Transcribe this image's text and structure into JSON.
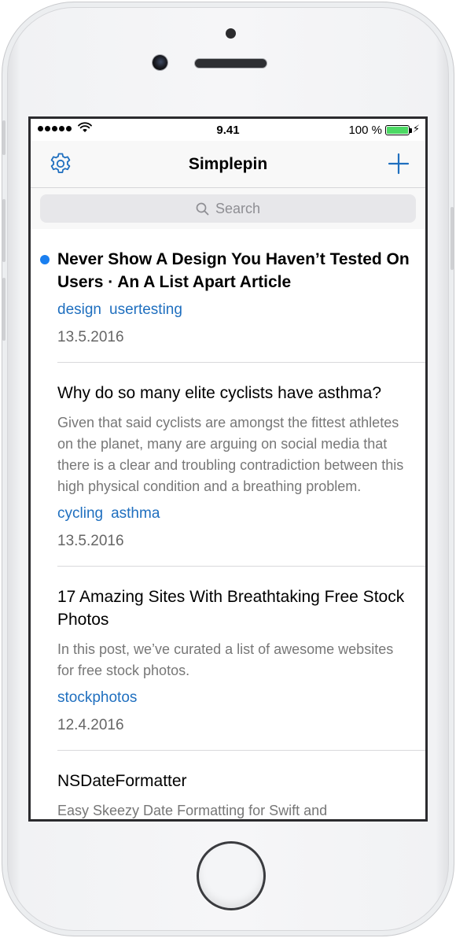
{
  "colors": {
    "accent": "#1F6FBF",
    "unread_dot": "#1A7FF0",
    "battery": "#4CD964",
    "description_text": "#777777",
    "date_text": "#666666"
  },
  "status_bar": {
    "time": "9.41",
    "battery_percent": "100 %",
    "signal_icon": "signal-dots-icon",
    "wifi_icon": "wifi-icon",
    "charging_icon": "bolt-icon"
  },
  "nav": {
    "title": "Simplepin",
    "left_icon": "gear-icon",
    "right_icon": "plus-icon"
  },
  "search": {
    "placeholder": "Search",
    "icon": "search-icon"
  },
  "items": [
    {
      "unread": true,
      "title": "Never Show A Design You Haven’t Tested On Users · An A List Apart Article",
      "description": "",
      "tags": [
        "design",
        "usertesting"
      ],
      "date": "13.5.2016"
    },
    {
      "unread": false,
      "title": "Why do so many elite cyclists have asthma?",
      "description": "Given that said cyclists are amongst the fittest athletes on the planet, many are arguing on social media that there is a clear and troubling contradiction between this high physical condition and a breathing problem.",
      "tags": [
        "cycling",
        "asthma"
      ],
      "date": "13.5.2016"
    },
    {
      "unread": false,
      "title": "17 Amazing Sites With Breathtaking Free Stock Photos",
      "description": "In this post, we’ve curated a list of awesome websites for free stock photos.",
      "tags": [
        "stockphotos"
      ],
      "date": "12.4.2016"
    },
    {
      "unread": false,
      "title": "NSDateFormatter",
      "description": "Easy Skeezy Date Formatting for Swift and",
      "tags": [],
      "date": ""
    }
  ]
}
